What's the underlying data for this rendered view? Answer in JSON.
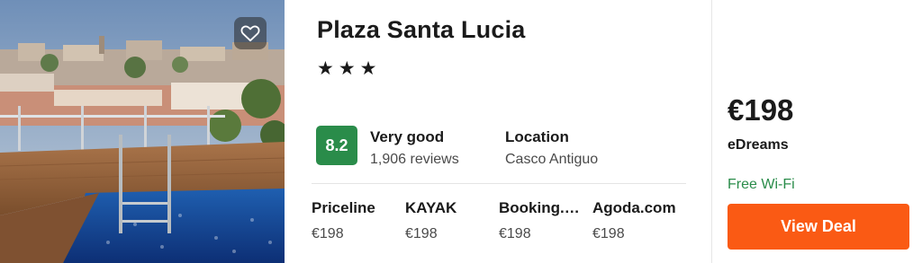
{
  "hotel": {
    "name": "Plaza Santa Lucia",
    "stars_text": "★★★",
    "star_count": 3,
    "score": "8.2",
    "rating_label": "Very good",
    "reviews": "1,906 reviews",
    "location_label": "Location",
    "location_value": "Casco Antiguo"
  },
  "providers": [
    {
      "name": "Priceline",
      "price": "€198"
    },
    {
      "name": "KAYAK",
      "price": "€198"
    },
    {
      "name": "Booking.com",
      "price": "€198"
    },
    {
      "name": "Agoda.com",
      "price": "€198"
    }
  ],
  "deal": {
    "price": "€198",
    "site": "eDreams",
    "amenity": "Free Wi-Fi",
    "button_label": "View Deal"
  },
  "icons": {
    "favorite": "heart-icon"
  },
  "colors": {
    "score_badge": "#2a8c4a",
    "amenity_text": "#2a8c4a",
    "cta_button": "#fa5a14"
  }
}
